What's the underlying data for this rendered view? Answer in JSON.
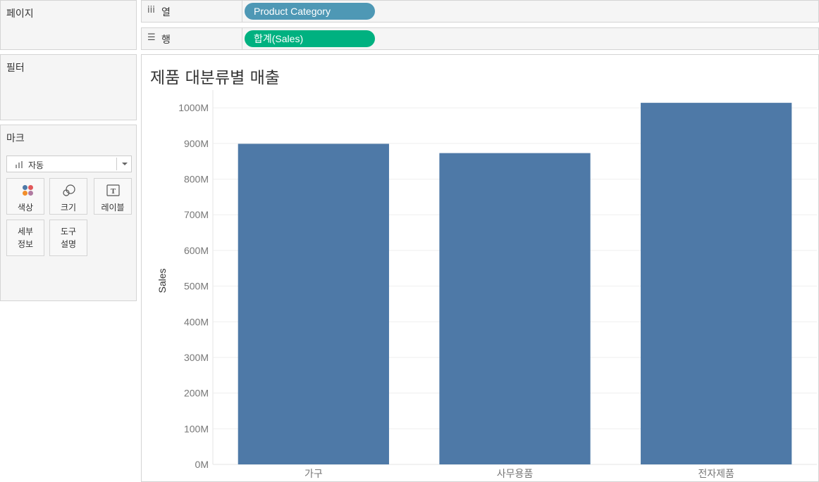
{
  "pages_panel": {
    "title": "페이지"
  },
  "filters_panel": {
    "title": "필터"
  },
  "marks_panel": {
    "title": "마크",
    "mark_type": "자동",
    "buttons": {
      "color": "색상",
      "size": "크기",
      "label": "레이블",
      "detail": "세부\n정보",
      "tooltip": "도구\n설명"
    }
  },
  "columns_shelf": {
    "label": "열",
    "icon": "columns-icon",
    "pill": "Product Category",
    "pill_color": "#4e98b5"
  },
  "rows_shelf": {
    "label": "행",
    "icon": "rows-icon",
    "pill": "합계(Sales)",
    "pill_color": "#00b180"
  },
  "view": {
    "title": "제품 대분류별 매출"
  },
  "chart_data": {
    "type": "bar",
    "categories": [
      "가구",
      "사무용품",
      "전자제품"
    ],
    "values": [
      899,
      873,
      1014
    ],
    "value_unit": "M",
    "ylabel": "Sales",
    "xlabel": "",
    "ylim": [
      0,
      1030
    ],
    "yticks": [
      0,
      100,
      200,
      300,
      400,
      500,
      600,
      700,
      800,
      900,
      1000
    ],
    "ytick_labels": [
      "0M",
      "100M",
      "200M",
      "300M",
      "400M",
      "500M",
      "600M",
      "700M",
      "800M",
      "900M",
      "1000M"
    ],
    "bar_color": "#4e79a7",
    "grid": true
  }
}
